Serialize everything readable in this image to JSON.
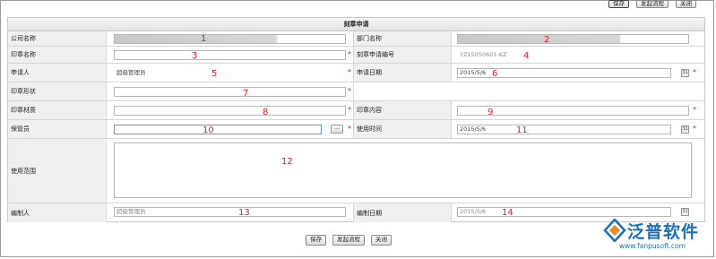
{
  "toolbar": {
    "save": "保存",
    "start_flow": "发起流程",
    "close": "关闭"
  },
  "form": {
    "title": "刻章申请",
    "rows": [
      {
        "label": "公司名称",
        "value": "",
        "num": "1",
        "label2": "部门名称",
        "value2": "",
        "num2": "2"
      },
      {
        "label": "印章名称",
        "value": "",
        "num": "3",
        "label2": "刻章申请编号",
        "value2": "YZ15050601-KZ",
        "num2": "4"
      },
      {
        "label": "申请人",
        "value": "超级管理员",
        "num": "5",
        "label2": "申请日期",
        "value2": "2015/5/6",
        "num2": "6"
      },
      {
        "label": "印章形状",
        "value": "",
        "num": "7"
      },
      {
        "label": "印章材质",
        "value": "",
        "num": "8",
        "label2": "印章内容",
        "value2": "",
        "num2": "9"
      },
      {
        "label": "保管员",
        "value": "",
        "num": "10",
        "label2": "使用时间",
        "value2": "2015/5/6",
        "num2": "11"
      },
      {
        "label": "使用范围",
        "value": "",
        "num": "12"
      },
      {
        "label": "编制人",
        "value": "超级管理员",
        "num": "13",
        "label2": "编制日期",
        "value2": "2015/5/6",
        "num2": "14"
      }
    ],
    "required_mark": "*",
    "browse_button": "..."
  },
  "bottom": {
    "save": "保存",
    "start_flow": "发起流程",
    "close": "关闭"
  },
  "watermark": {
    "name": "泛普软件",
    "url": "www.fanpusoft.com"
  },
  "colors": {
    "required": "#e02020",
    "annotation": "#e02020",
    "brand": "#1d6fb8"
  }
}
